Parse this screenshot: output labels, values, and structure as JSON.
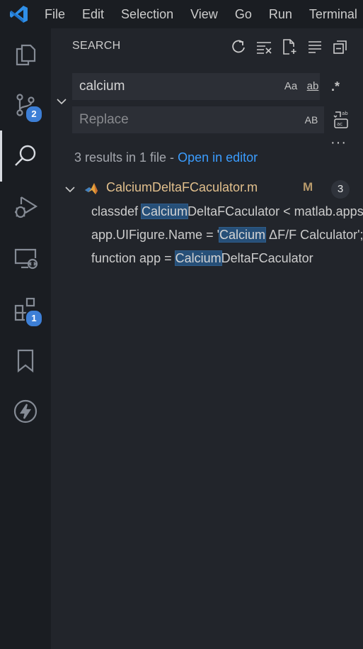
{
  "menu": [
    "File",
    "Edit",
    "Selection",
    "View",
    "Go",
    "Run",
    "Terminal"
  ],
  "activity": {
    "scm_badge": "2",
    "extensions_badge": "1"
  },
  "search": {
    "title": "SEARCH",
    "query": "calcium",
    "replace_placeholder": "Replace",
    "opt_match_case": "Aa",
    "opt_whole_word": "ab",
    "opt_regex": ".*",
    "opt_preserve_case": "AB",
    "more": "···",
    "summary_text": "3 results in 1 file - ",
    "open_in_editor": "Open in editor"
  },
  "results": {
    "file_name": "CalciumDeltaFCaculator.m",
    "file_status": "M",
    "file_count": "3",
    "matches": [
      {
        "before": "classdef ",
        "hit": "Calcium",
        "after": "DeltaFCaculator < matlab.apps.AppBase"
      },
      {
        "before": "app.UIFigure.Name = '",
        "hit": "Calcium",
        "after": " ΔF/F Calculator';"
      },
      {
        "before": "function app = ",
        "hit": "Calcium",
        "after": "DeltaFCaculator"
      }
    ]
  },
  "colors": {
    "accent": "#3d7fd6",
    "link": "#3b9dff",
    "modified": "#e2c08d",
    "highlight": "#264f78"
  }
}
